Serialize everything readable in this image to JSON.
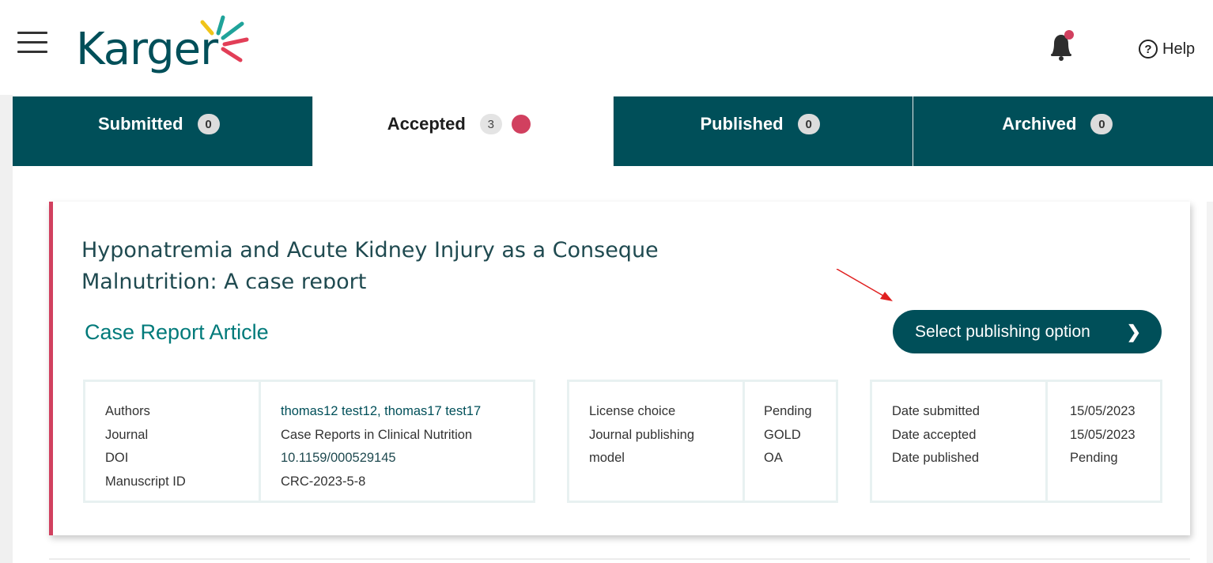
{
  "header": {
    "logo_text": "Karger",
    "help_label": "Help",
    "notification_dot_color": "#d1405f"
  },
  "tabs": [
    {
      "label": "Submitted",
      "count": "0",
      "active": false
    },
    {
      "label": "Accepted",
      "count": "3",
      "active": true,
      "has_dot": true
    },
    {
      "label": "Published",
      "count": "0",
      "active": false
    },
    {
      "label": "Archived",
      "count": "0",
      "active": false
    }
  ],
  "card": {
    "title_line1": "Hyponatremia and Acute Kidney Injury as a Conseque",
    "title_line2": "Malnutrition: A case report",
    "article_type": "Case Report Article",
    "select_button": "Select publishing option",
    "accent_color": "#d1405f",
    "box1": {
      "labels": [
        "Authors",
        "Journal",
        "DOI",
        "Manuscript ID"
      ],
      "values": [
        "thomas12 test12, thomas17 test17",
        "Case Reports in Clinical Nutrition",
        "10.1159/000529145",
        "CRC-2023-5-8"
      ]
    },
    "box2": {
      "label1": "License choice",
      "label2": "Journal publishing model",
      "value1": "Pending",
      "value2": "GOLD OA"
    },
    "box3": {
      "labels": [
        "Date submitted",
        "Date accepted",
        "Date published"
      ],
      "values": [
        "15/05/2023",
        "15/05/2023",
        "Pending"
      ]
    }
  },
  "colors": {
    "primary": "#004f59",
    "accent": "#d1405f",
    "article_type": "#007a7a"
  }
}
